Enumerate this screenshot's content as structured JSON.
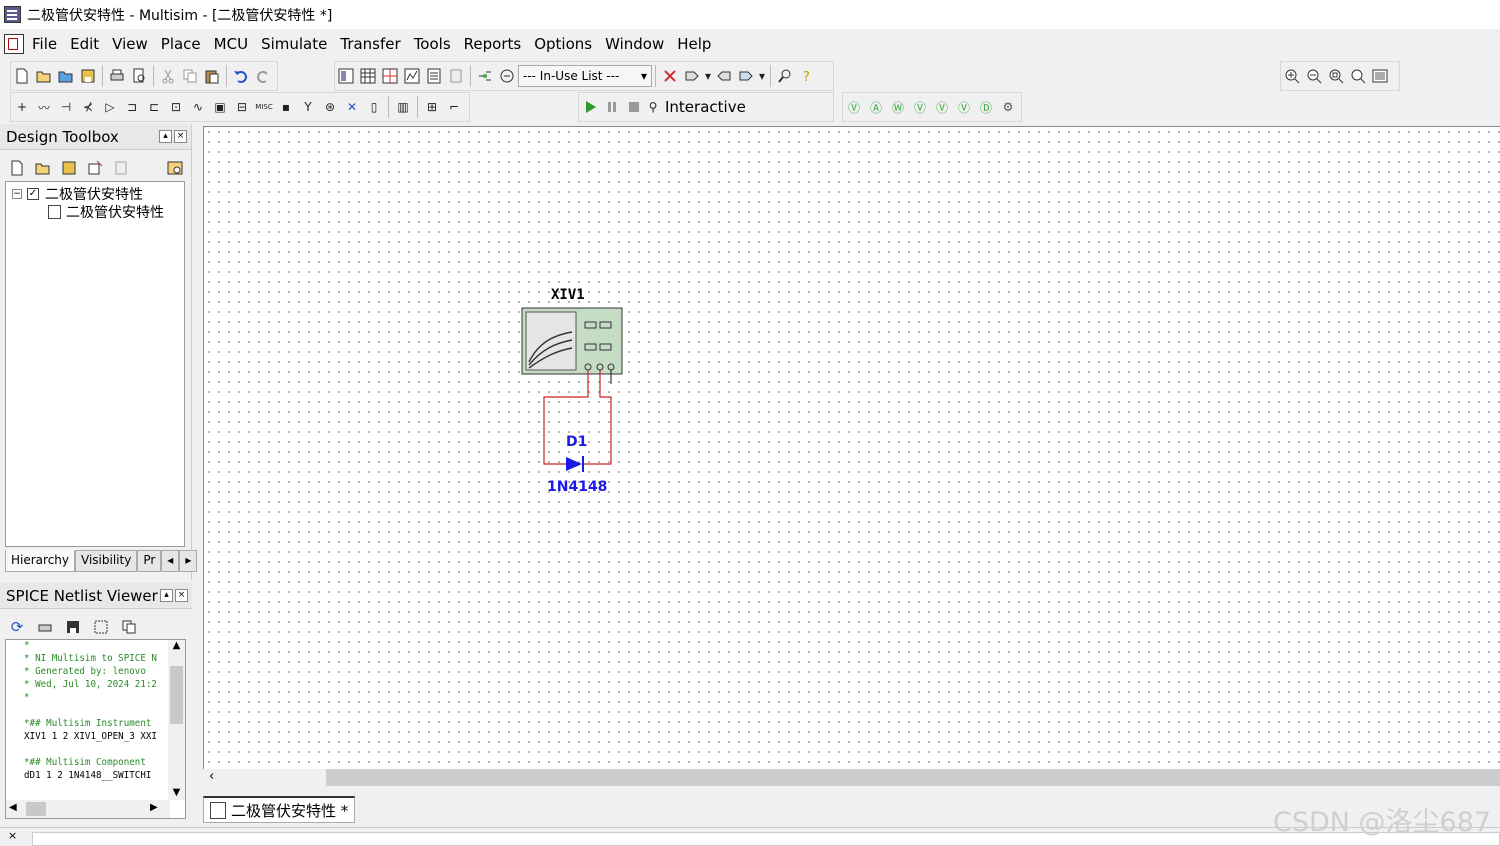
{
  "window": {
    "title": "二极管伏安特性 - Multisim - [二极管伏安特性 *]"
  },
  "menu": [
    "File",
    "Edit",
    "View",
    "Place",
    "MCU",
    "Simulate",
    "Transfer",
    "Tools",
    "Reports",
    "Options",
    "Window",
    "Help"
  ],
  "toolbar": {
    "inuse_list": "--- In-Use List ---",
    "interactive_label": "Interactive"
  },
  "design_toolbox": {
    "title": "Design Toolbox",
    "tree": {
      "root": "二极管伏安特性",
      "child": "二极管伏安特性"
    },
    "tabs": [
      "Hierarchy",
      "Visibility",
      "Pr"
    ]
  },
  "spice": {
    "title": "SPICE Netlist Viewer",
    "lines": [
      "*",
      "* NI Multisim to SPICE N",
      "* Generated by: lenovo",
      "* Wed, Jul 10, 2024 21:2",
      "*",
      "",
      "*## Multisim Instrument",
      "XIV1 1 2 XIV1_OPEN_3 XXI",
      "",
      "*## Multisim Component",
      "dD1 1 2 1N4148__SWITCHI"
    ]
  },
  "schematic": {
    "instrument_ref": "XIV1",
    "diode_ref": "D1",
    "diode_value": "1N4148",
    "wire_color": "#cc2222",
    "label_color": "#1a1ae6"
  },
  "document_tab": "二极管伏安特性 *",
  "watermark": "CSDN @洛尘687"
}
